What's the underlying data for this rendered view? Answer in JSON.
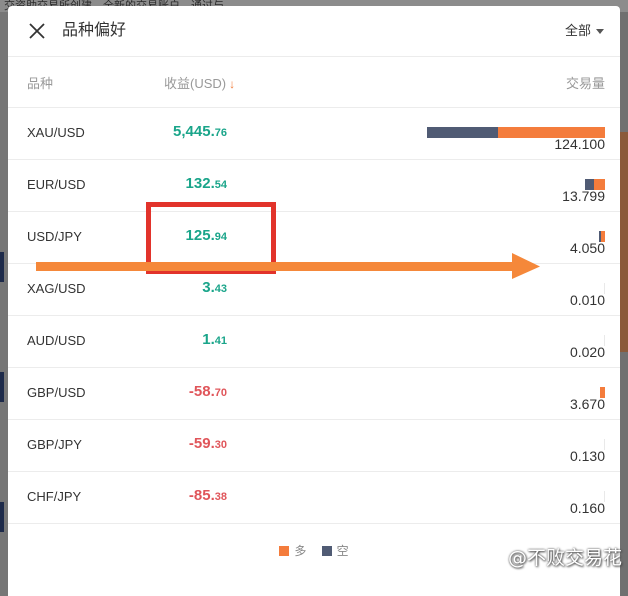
{
  "background": {
    "top_text": "交资助交易所创建。全新的交易账户，通过与"
  },
  "modal": {
    "title": "品种偏好",
    "filter": {
      "selected": "全部"
    },
    "columns": {
      "symbol": "品种",
      "profit": "收益(USD)",
      "sort_icon": "arrow-down-icon",
      "volume": "交易量"
    },
    "rows": [
      {
        "symbol": "XAU/USD",
        "profit_int": "5,445.",
        "profit_dec": "76",
        "sign": "positive",
        "volume": "124.100",
        "long_fraction": 0.6,
        "short_fraction": 0.4
      },
      {
        "symbol": "EUR/USD",
        "profit_int": "132.",
        "profit_dec": "54",
        "sign": "positive",
        "volume": "13.799",
        "long_fraction": 0.55,
        "short_fraction": 0.45
      },
      {
        "symbol": "USD/JPY",
        "profit_int": "125.",
        "profit_dec": "94",
        "sign": "positive",
        "volume": "4.050",
        "long_fraction": 0.6,
        "short_fraction": 0.4
      },
      {
        "symbol": "XAG/USD",
        "profit_int": "3.",
        "profit_dec": "43",
        "sign": "positive",
        "volume": "0.010",
        "long_fraction": 0.5,
        "short_fraction": 0.5
      },
      {
        "symbol": "AUD/USD",
        "profit_int": "1.",
        "profit_dec": "41",
        "sign": "positive",
        "volume": "0.020",
        "long_fraction": 0.5,
        "short_fraction": 0.5
      },
      {
        "symbol": "GBP/USD",
        "profit_int": "-58.",
        "profit_dec": "70",
        "sign": "negative",
        "volume": "3.670",
        "long_fraction": 1.0,
        "short_fraction": 0.0
      },
      {
        "symbol": "GBP/JPY",
        "profit_int": "-59.",
        "profit_dec": "30",
        "sign": "negative",
        "volume": "0.130",
        "long_fraction": 0.5,
        "short_fraction": 0.5
      },
      {
        "symbol": "CHF/JPY",
        "profit_int": "-85.",
        "profit_dec": "38",
        "sign": "negative",
        "volume": "0.160",
        "long_fraction": 0.5,
        "short_fraction": 0.5
      }
    ],
    "legend": {
      "long_label": "多",
      "short_label": "空"
    }
  },
  "colors": {
    "long": "#f47c3c",
    "short": "#505b74",
    "profit_positive": "#1aa58a",
    "profit_negative": "#e0555a",
    "highlight": "#e2332b",
    "arrow": "#f5883a"
  },
  "watermark": {
    "text": "@不败交易花"
  }
}
